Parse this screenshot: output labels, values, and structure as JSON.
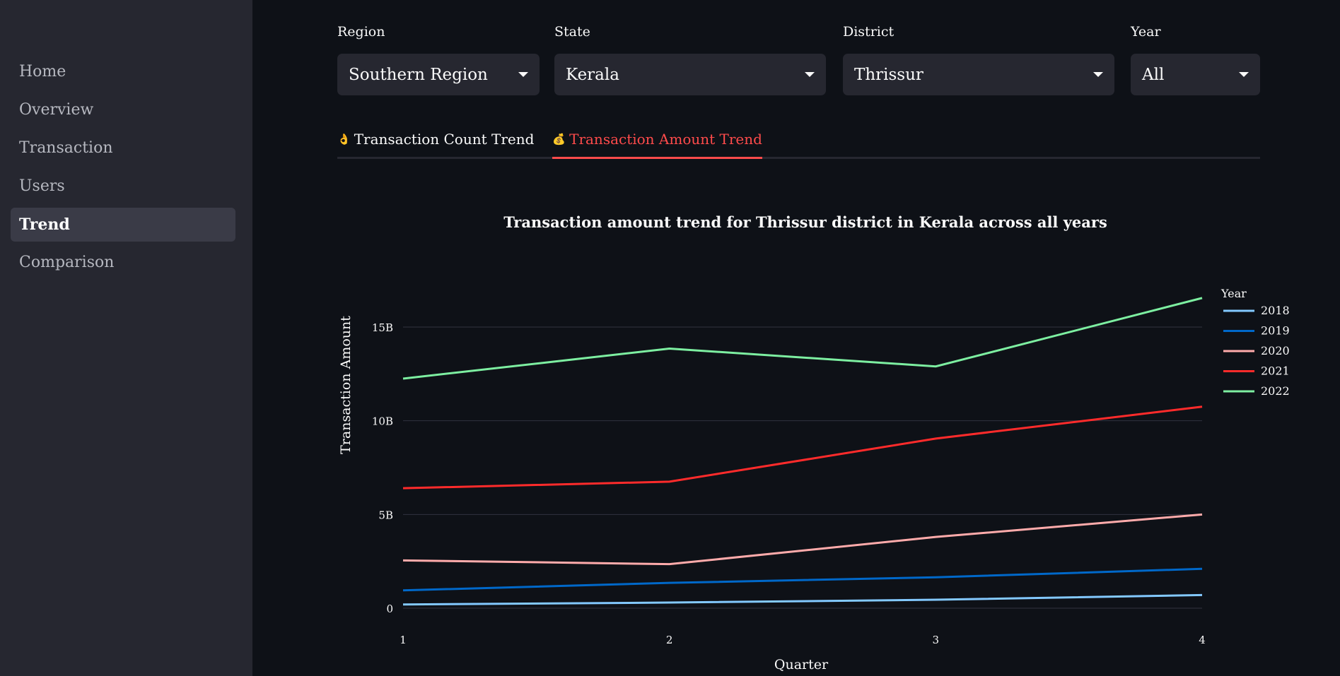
{
  "sidebar": {
    "items": [
      {
        "label": "Home",
        "active": false
      },
      {
        "label": "Overview",
        "active": false
      },
      {
        "label": "Transaction",
        "active": false
      },
      {
        "label": "Users",
        "active": false
      },
      {
        "label": "Trend",
        "active": true
      },
      {
        "label": "Comparison",
        "active": false
      }
    ]
  },
  "filters": {
    "region": {
      "label": "Region",
      "value": "Southern Region"
    },
    "state": {
      "label": "State",
      "value": "Kerala"
    },
    "district": {
      "label": "District",
      "value": "Thrissur"
    },
    "year": {
      "label": "Year",
      "value": "All"
    }
  },
  "tabs": [
    {
      "label": "Transaction Count Trend",
      "icon": "money-hand-icon",
      "active": false
    },
    {
      "label": "Transaction Amount Trend",
      "icon": "money-bag-icon",
      "active": true
    }
  ],
  "colors": {
    "accent": "#ff4b4b",
    "background": "#0e1117",
    "sidebar": "#262730"
  },
  "chart_data": {
    "type": "line",
    "title": "Transaction amount trend for Thrissur district in Kerala across all years",
    "xlabel": "Quarter",
    "ylabel": "Transaction Amount",
    "x": [
      1,
      2,
      3,
      4
    ],
    "x_ticks": [
      "1",
      "2",
      "3",
      "4"
    ],
    "y_ticks": [
      {
        "value": 0,
        "label": "0"
      },
      {
        "value": 5000000000,
        "label": "5B"
      },
      {
        "value": 10000000000,
        "label": "10B"
      },
      {
        "value": 15000000000,
        "label": "15B"
      }
    ],
    "ylim": [
      -500000000,
      16500000000
    ],
    "grid": true,
    "legend_title": "Year",
    "legend_position": "top-right",
    "series": [
      {
        "name": "2018",
        "color": "#83c9ff",
        "values": [
          200000000,
          300000000,
          450000000,
          700000000
        ]
      },
      {
        "name": "2019",
        "color": "#0068c9",
        "values": [
          950000000,
          1350000000,
          1650000000,
          2100000000
        ]
      },
      {
        "name": "2020",
        "color": "#ffabab",
        "values": [
          2550000000,
          2350000000,
          3800000000,
          5000000000
        ]
      },
      {
        "name": "2021",
        "color": "#ff2b2b",
        "values": [
          6400000000,
          6750000000,
          9050000000,
          10750000000
        ]
      },
      {
        "name": "2022",
        "color": "#7defa1",
        "values": [
          12250000000,
          13850000000,
          12900000000,
          16550000000
        ]
      }
    ]
  }
}
